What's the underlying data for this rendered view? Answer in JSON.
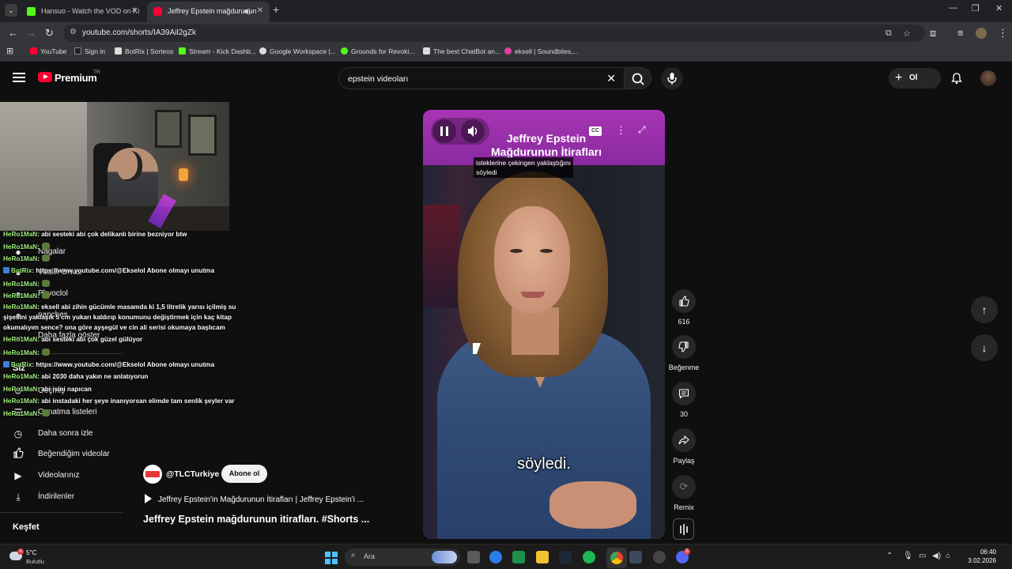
{
  "browser": {
    "tabs": [
      {
        "title": "Hansuo - Watch the VOD on Ki",
        "favicon": "kick-icon",
        "active": false
      },
      {
        "title": "Jeffrey Epstein mağdurunun",
        "favicon": "youtube-icon",
        "active": true
      }
    ],
    "url": "youtube.com/shorts/IA39Ail2gZk",
    "bookmarks": [
      {
        "label": "YouTube",
        "color": "#ff0033"
      },
      {
        "label": "Sign in",
        "color": "#202020"
      },
      {
        "label": "BotRix | Sorteos",
        "color": "#dddddd"
      },
      {
        "label": "Stream - Kick Dashb...",
        "color": "#53fc18"
      },
      {
        "label": "Google Workspace |...",
        "color": "#dddddd"
      },
      {
        "label": "Grounds for Revoki...",
        "color": "#53fc18"
      },
      {
        "label": "The best ChatBot an...",
        "color": "#dddddd"
      },
      {
        "label": "eksell | Soundbites,...",
        "color": "#e23fa0"
      }
    ]
  },
  "youtube": {
    "brand": "Premium",
    "country": "TR",
    "search_query": "epstein videoları",
    "create_label": "Ol",
    "sidebar": {
      "items": [
        {
          "label": "Nagalar",
          "icon": "avatar-icon"
        },
        {
          "label": "Vitalik Orwar",
          "icon": "avatar-icon"
        },
        {
          "label": "Phvoclol",
          "icon": "avatar-icon"
        },
        {
          "label": "panches",
          "icon": "avatar-icon"
        },
        {
          "label": "Daha fazla göster",
          "icon": "chevron-down-icon"
        },
        {
          "label": "Siz",
          "icon": ""
        },
        {
          "label": "Geçmiş",
          "icon": "history-icon"
        },
        {
          "label": "Oynatma listeleri",
          "icon": "playlist-icon"
        },
        {
          "label": "Daha sonra izle",
          "icon": "clock-icon"
        },
        {
          "label": "Beğendiğim videolar",
          "icon": "thumbs-up-icon"
        },
        {
          "label": "Videolarınız",
          "icon": "play-box-icon"
        },
        {
          "label": "İndirilenler",
          "icon": "download-icon"
        }
      ],
      "section_explore": "Keşfet"
    },
    "chat": [
      {
        "user": "HeRo1MaN",
        "msg": ": abi sesteki abi çok delikanlı birine bezniyor btw",
        "bot": false
      },
      {
        "user": "HeRo1MaN",
        "msg": ":",
        "bot": false,
        "emote": true
      },
      {
        "user": "HeRo1MaN",
        "msg": ":",
        "bot": false,
        "emote": true
      },
      {
        "user": "BotRix",
        "msg": ": https://www.youtube.com/@Ekselol Abone olmayı unutma",
        "bot": true
      },
      {
        "user": "HeRo1MaN",
        "msg": ":",
        "bot": false,
        "emote": true
      },
      {
        "user": "HeRo1MaN",
        "msg": ":",
        "bot": false,
        "emote": true
      },
      {
        "user": "HeRo1MaN",
        "msg": ": eksell abi zihin gücümle masamda ki 1,5 litrelik yarısı içilmiş su",
        "bot": false
      },
      {
        "user": "",
        "msg": "şişesini yaklaşık 5 cm yukarı kaldırıp konumunu değiştirmek için kaç kitap",
        "bot": false
      },
      {
        "user": "",
        "msg": "okumalıyım sence? ona göre ayşegül ve cin ali serisi okumaya başlıcam",
        "bot": false
      },
      {
        "user": "HeRo1MaN",
        "msg": ": abi sesteki abi çok güzel gülüyor",
        "bot": false
      },
      {
        "user": "HeRo1MaN",
        "msg": ":",
        "bot": false,
        "emote": true
      },
      {
        "user": "BotRix",
        "msg": ": https://www.youtube.com/@Ekselol Abone olmayı unutma",
        "bot": true
      },
      {
        "user": "HeRo1MaN",
        "msg": ": abi 2030 daha yakın ne anlatıyorun",
        "bot": false
      },
      {
        "user": "HeRo1MaN",
        "msg": ": abi isini napıcan",
        "bot": false
      },
      {
        "user": "HeRo1MaN",
        "msg": ": abi instadaki her şeye inanıyorsan elimde tam senlik şeyler var",
        "bot": false
      },
      {
        "user": "HeRo1MaN",
        "msg": ":",
        "bot": false,
        "emote": true
      }
    ],
    "short": {
      "overlay_title": "Jeffrey Epstein Mağdurunun İtirafları",
      "caption_top_line1": "isteklerine çekingen yaklaştığını",
      "caption_top_line2": "söyledi",
      "caption_bottom": "söyledi.",
      "cc_label": "CC",
      "channel": "@TLCTurkiye",
      "subscribe_label": "Abone ol",
      "related": "Jeffrey Epstein'in Mağdurunun İtirafları | Jeffrey Epstein'i ...",
      "title": "Jeffrey Epstein mağdurunun itirafları. #Shorts ..."
    },
    "actions": {
      "like_count": "616",
      "dislike_label": "Beğenme",
      "comment_count": "30",
      "share_label": "Paylaş",
      "remix_label": "Remix"
    }
  },
  "taskbar": {
    "temperature": "5°C",
    "weather": "Bulutlu",
    "weather_badge": "4",
    "search_label": "Ara",
    "time": "06:40",
    "date": "3.02.2026",
    "discord_badge": "5"
  }
}
